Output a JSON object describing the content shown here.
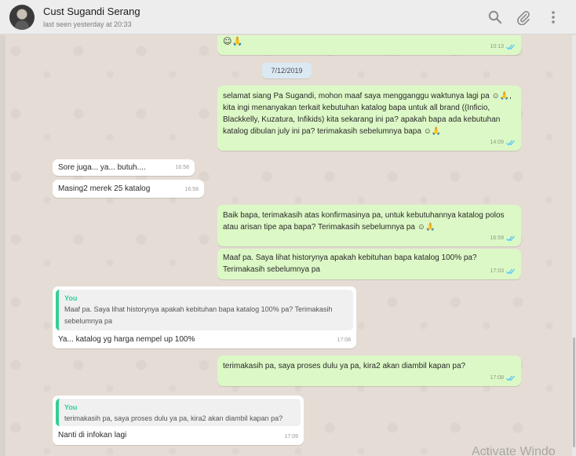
{
  "header": {
    "contact_name": "Cust Sugandi Serang",
    "last_seen": "last seen yesterday at 20:33",
    "icons": [
      "search-icon",
      "attach-icon",
      "menu-icon"
    ]
  },
  "messages": [
    {
      "id": "m0",
      "direction": "out",
      "text": "☺🙏",
      "time": "10:13",
      "ticks": "read"
    },
    {
      "id": "date",
      "type": "date",
      "text": "7/12/2019"
    },
    {
      "id": "m1",
      "direction": "out",
      "text": "selamat siang  Pa Sugandi, mohon maaf saya mengganggu waktunya lagi pa ☺🙏, kita ingi menanyakan terkait kebutuhan katalog bapa untuk all brand ((Inficio, Blackkelly, Kuzatura, Infikids) kita sekarang ini pa? apakah bapa ada kebutuhan katalog dibulan july ini pa? terimakasih sebelumnya bapa ☺🙏",
      "time": "14:09",
      "ticks": "read"
    },
    {
      "id": "m2",
      "direction": "in",
      "text": "Sore juga... ya... butuh....",
      "time": "16:58"
    },
    {
      "id": "m3",
      "direction": "in",
      "text": "Masing2 merek 25 katalog",
      "time": "16:58"
    },
    {
      "id": "m4",
      "direction": "out",
      "text": "Baik bapa,  terimakasih atas konfirmasinya pa, untuk kebutuhannya katalog polos atau arisan tipe apa bapa?  Terimakasih sebelumnya pa ☺🙏",
      "time": "16:59",
      "ticks": "read"
    },
    {
      "id": "m5",
      "direction": "out",
      "text": "Maaf pa. Saya lihat historynya apakah kebituhan bapa katalog 100% pa? Terimakasih sebelumnya pa",
      "time": "17:03",
      "ticks": "read"
    },
    {
      "id": "m6",
      "direction": "in",
      "quote_author": "You",
      "quote_text": "Maaf pa. Saya lihat historynya apakah kebituhan bapa katalog 100% pa? Terimakasih sebelumnya pa",
      "text": "Ya... katalog yg harga nempel up 100%",
      "time": "17:08"
    },
    {
      "id": "m7",
      "direction": "out",
      "text": "terimakasih pa, saya proses dulu ya pa, kira2 akan diambil kapan pa?",
      "time": "17:08",
      "ticks": "read"
    },
    {
      "id": "m8",
      "direction": "in",
      "quote_author": "You",
      "quote_text": "terimakasih pa, saya proses dulu ya pa, kira2 akan diambil kapan pa?",
      "text": "Nanti di infokan lagi",
      "time": "17:09"
    }
  ],
  "colors": {
    "outgoing": "#dcf8c6",
    "incoming": "#ffffff",
    "read_ticks": "#4fc3f7",
    "quote_accent": "#35cd96",
    "chat_background": "#e5ddd5"
  },
  "watermark": "Activate Windo"
}
